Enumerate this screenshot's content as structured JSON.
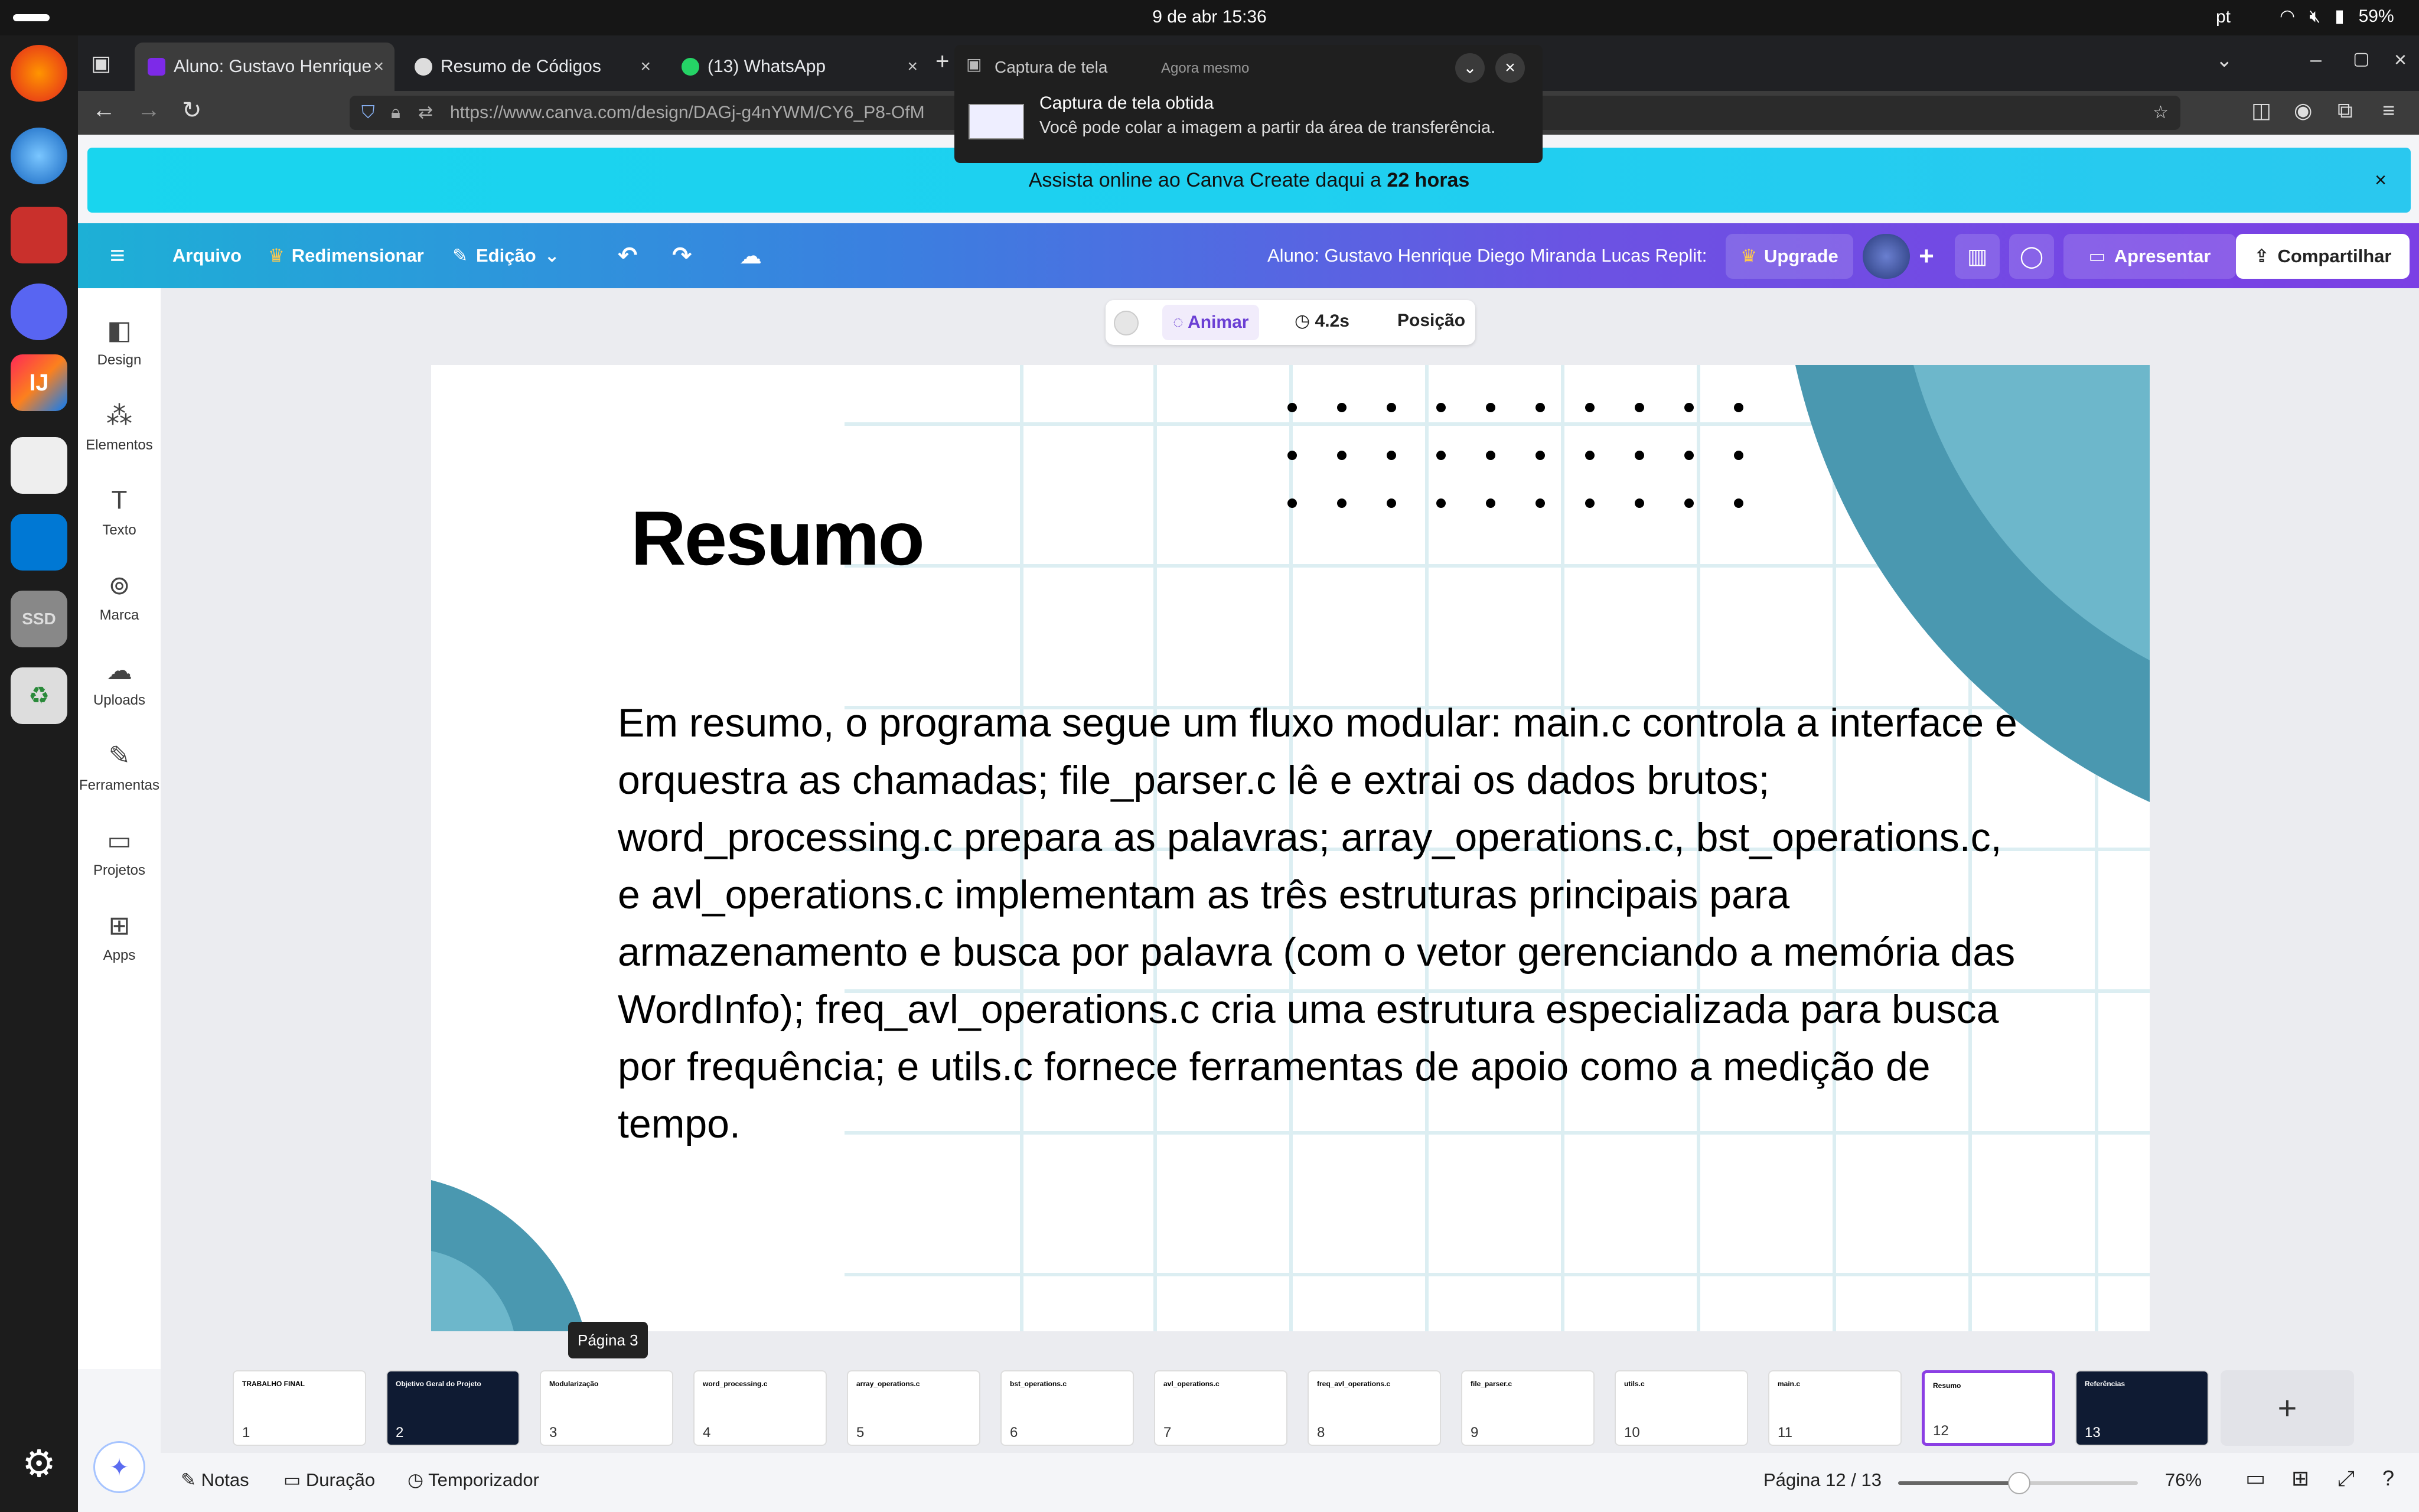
{
  "system": {
    "clock": "9 de abr  15:36",
    "lang": "pt",
    "battery": "59%"
  },
  "browser": {
    "tabs": [
      {
        "label": "Aluno: Gustavo Henrique"
      },
      {
        "label": "Resumo de Códigos"
      },
      {
        "label": "(13) WhatsApp"
      }
    ],
    "url": "https://www.canva.com/design/DAGj-g4nYWM/CY6_P8-OfM"
  },
  "notification": {
    "app": "Captura de tela",
    "time": "Agora mesmo",
    "title": "Captura de tela obtida",
    "body": "Você pode colar a imagem a partir da área de transferência."
  },
  "banner": {
    "text_prefix": "Assista online ao Canva Create daqui a ",
    "text_bold": "22 horas"
  },
  "toolbar": {
    "file": "Arquivo",
    "resize": "Redimensionar",
    "edit": "Edição",
    "doc_title": "Aluno: Gustavo Henrique Diego Miranda Lucas Replit:",
    "upgrade": "Upgrade",
    "present": "Apresentar",
    "share": "Compartilhar"
  },
  "rail": [
    {
      "label": "Design"
    },
    {
      "label": "Elementos"
    },
    {
      "label": "Texto"
    },
    {
      "label": "Marca"
    },
    {
      "label": "Uploads"
    },
    {
      "label": "Ferramentas"
    },
    {
      "label": "Projetos"
    },
    {
      "label": "Apps"
    }
  ],
  "context": {
    "animate": "Animar",
    "duration": "4.2s",
    "position": "Posição"
  },
  "slide": {
    "title": "Resumo",
    "body": "Em resumo, o programa segue um fluxo modular: main.c controla a interface e orquestra as chamadas; file_parser.c lê e extrai os dados brutos; word_processing.c prepara as palavras; array_operations.c, bst_operations.c, e avl_operations.c implementam as três estruturas principais para armazenamento e busca por palavra (com o vetor gerenciando a memória das WordInfo); freq_avl_operations.c cria uma estrutura especializada para busca por frequência; e utils.c fornece ferramentas de apoio como a medição de tempo."
  },
  "page_tooltip": "Página 3",
  "thumbnails": [
    {
      "num": "1",
      "title": "TRABALHO FINAL"
    },
    {
      "num": "2",
      "title": "Objetivo Geral do Projeto"
    },
    {
      "num": "3",
      "title": "Modularização"
    },
    {
      "num": "4",
      "title": "word_processing.c"
    },
    {
      "num": "5",
      "title": "array_operations.c"
    },
    {
      "num": "6",
      "title": "bst_operations.c"
    },
    {
      "num": "7",
      "title": "avl_operations.c"
    },
    {
      "num": "8",
      "title": "freq_avl_operations.c"
    },
    {
      "num": "9",
      "title": "file_parser.c"
    },
    {
      "num": "10",
      "title": "utils.c"
    },
    {
      "num": "11",
      "title": "main.c"
    },
    {
      "num": "12",
      "title": "Resumo"
    },
    {
      "num": "13",
      "title": "Referências"
    }
  ],
  "footer": {
    "notes": "Notas",
    "duration": "Duração",
    "timer": "Temporizador",
    "page": "Página 12 / 13",
    "zoom": "76%"
  }
}
